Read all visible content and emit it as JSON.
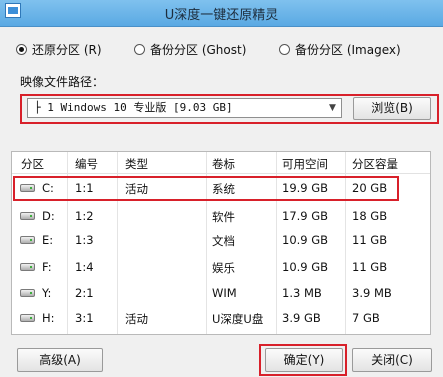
{
  "window": {
    "title": "U深度一键还原精灵"
  },
  "restore_options": [
    {
      "label": "还原分区 (R)",
      "selected": true
    },
    {
      "label": "备份分区 (Ghost)",
      "selected": false
    },
    {
      "label": "备份分区 (Imagex)",
      "selected": false
    }
  ],
  "image_path": {
    "label": "映像文件路径：",
    "value": "├ 1 Windows 10 专业版 [9.03 GB]",
    "browse_label": "浏览(B)"
  },
  "table": {
    "headers": [
      "分区",
      "编号",
      "类型",
      "卷标",
      "可用空间",
      "分区容量"
    ],
    "rows": [
      {
        "partition": "C:",
        "number": "1:1",
        "type": "活动",
        "label": "系统",
        "free": "19.9 GB",
        "capacity": "20 GB"
      },
      {
        "partition": "D:",
        "number": "1:2",
        "type": "",
        "label": "软件",
        "free": "17.9 GB",
        "capacity": "18 GB"
      },
      {
        "partition": "E:",
        "number": "1:3",
        "type": "",
        "label": "文档",
        "free": "10.9 GB",
        "capacity": "11 GB"
      },
      {
        "partition": "F:",
        "number": "1:4",
        "type": "",
        "label": "娱乐",
        "free": "10.9 GB",
        "capacity": "11 GB"
      },
      {
        "partition": "Y:",
        "number": "2:1",
        "type": "",
        "label": "WIM",
        "free": "1.3 MB",
        "capacity": "3.9 MB"
      },
      {
        "partition": "H:",
        "number": "3:1",
        "type": "活动",
        "label": "U深度U盘",
        "free": "3.9 GB",
        "capacity": "7 GB"
      }
    ]
  },
  "buttons": {
    "advanced": "高级(A)",
    "ok": "确定(Y)",
    "close": "关闭(C)"
  },
  "colors": {
    "title_bar": "#5aa9e3",
    "highlight_box": "#d8202a"
  }
}
